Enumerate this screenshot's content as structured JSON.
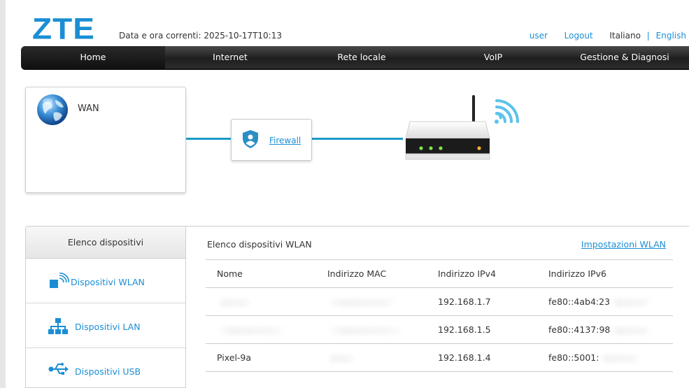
{
  "header": {
    "logo": "ZTE",
    "datetime": "Data e ora correnti: 2025-10-17T10:13",
    "user_link": "user",
    "logout_link": "Logout",
    "lang_current": "Italiano",
    "lang_sep": "|",
    "lang_other": "English"
  },
  "nav": {
    "items": [
      "Home",
      "Internet",
      "Rete locale",
      "VoIP",
      "Gestione & Diagnosi"
    ],
    "active": "Home"
  },
  "topology": {
    "wan_label": "WAN",
    "firewall_link": "Firewall"
  },
  "sidebar": {
    "title": "Elenco dispositivi",
    "items": [
      {
        "label": "Dispositivi WLAN",
        "icon": "wifi-device-icon"
      },
      {
        "label": "Dispositivi LAN",
        "icon": "lan-network-icon"
      },
      {
        "label": "Dispositivi USB",
        "icon": "usb-icon"
      }
    ]
  },
  "content": {
    "title": "Elenco dispositivi WLAN",
    "settings_link": "Impostazioni WLAN",
    "columns": [
      "Nome",
      "Indirizzo MAC",
      "Indirizzo IPv4",
      "Indirizzo IPv6"
    ],
    "rows": [
      {
        "name": "",
        "mac": "",
        "ipv4": "192.168.1.7",
        "ipv6": "fe80::4ab4:23"
      },
      {
        "name": "",
        "mac": "",
        "ipv4": "192.168.1.5",
        "ipv6": "fe80::4137:98"
      },
      {
        "name": "Pixel-9a",
        "mac": "",
        "ipv4": "192.168.1.4",
        "ipv6": "fe80::5001:"
      }
    ]
  },
  "colors": {
    "accent": "#1a8ed4",
    "link_line": "#1a9bc8"
  }
}
